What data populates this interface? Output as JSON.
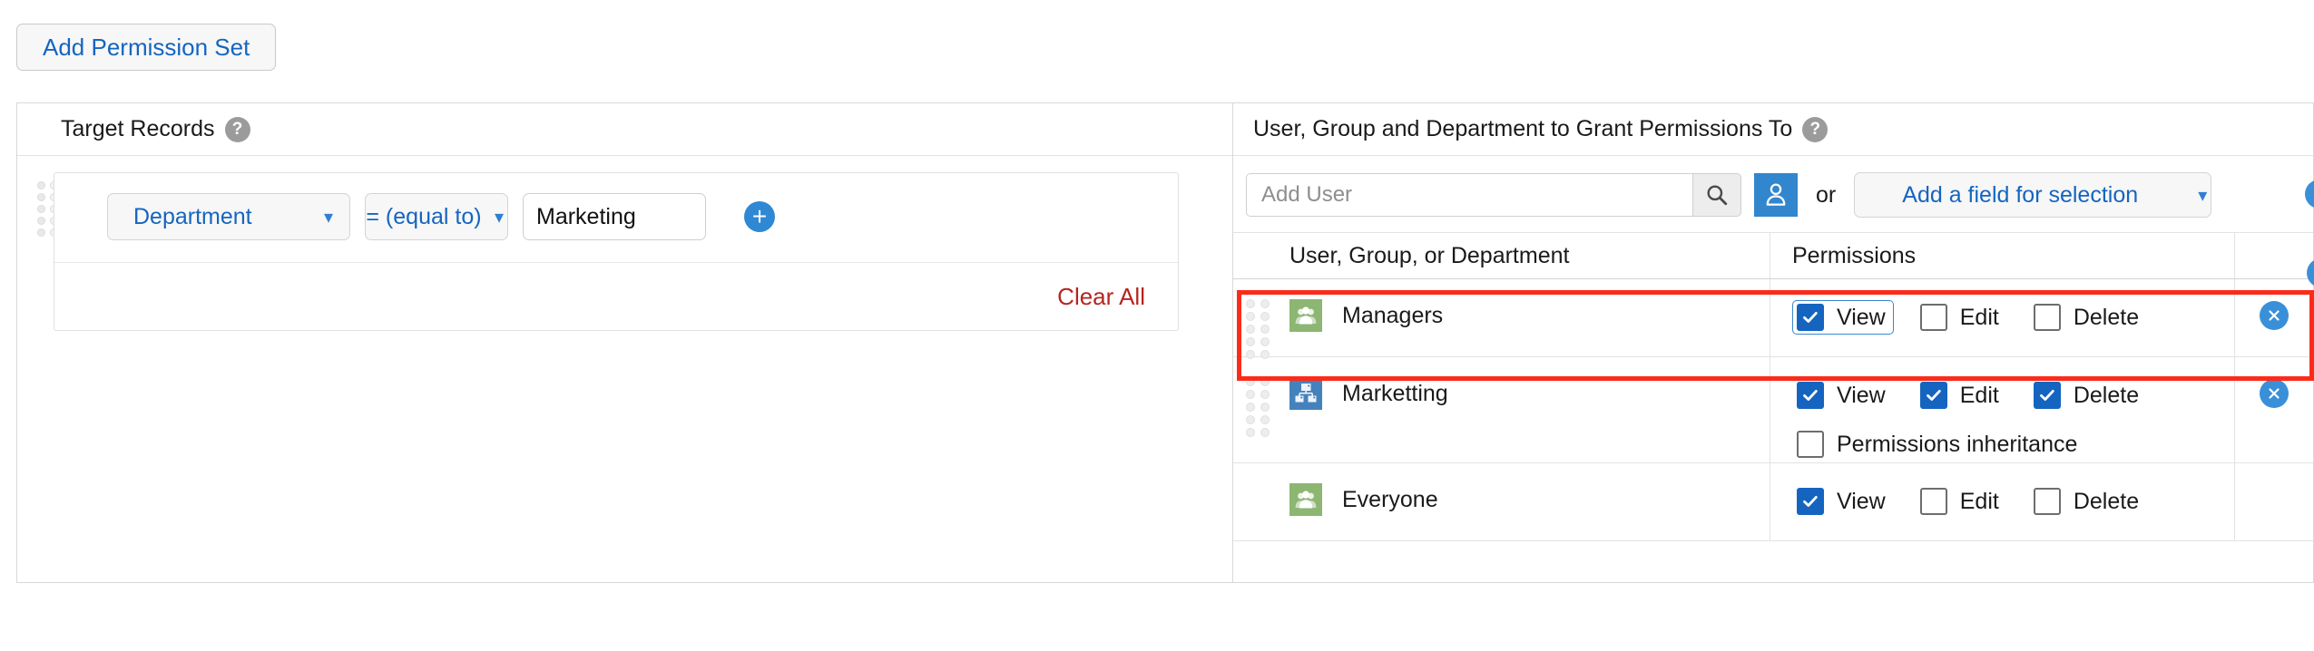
{
  "toolbar": {
    "add_permission_set_label": "Add Permission Set"
  },
  "left_panel": {
    "title": "Target Records",
    "help_icon": "help-circle-icon",
    "filter": {
      "field_value": "Department",
      "operator_value": "= (equal to)",
      "text_value": "Marketing",
      "text_placeholder": "",
      "add_icon": "plus-icon",
      "chevron_icon": "chevron-down-icon"
    },
    "clear_all_label": "Clear All",
    "clear_all_color": "#b5251f"
  },
  "right_panel": {
    "title": "User, Group and Department to Grant Permissions To",
    "help_icon": "help-circle-icon",
    "search": {
      "value": "",
      "placeholder": "Add User",
      "search_icon": "search-icon",
      "user_picker_icon": "user-icon",
      "or_label": "or",
      "add_field_label": "Add a field for selection",
      "chevron_icon": "chevron-down-icon"
    },
    "table": {
      "headers": {
        "name": "User, Group, or Department",
        "permissions": "Permissions",
        "actions": ""
      },
      "rows": [
        {
          "name": "Managers",
          "icon": "group-icon",
          "icon_kind": "group",
          "has_drag_handle": true,
          "has_remove": true,
          "remove_icon": "close-circle-icon",
          "highlighted": true,
          "permissions": [
            {
              "label": "View",
              "checked": true,
              "focused": true
            },
            {
              "label": "Edit",
              "checked": false,
              "focused": false
            },
            {
              "label": "Delete",
              "checked": false,
              "focused": false
            }
          ],
          "inheritance": null
        },
        {
          "name": "Marketting",
          "icon": "department-icon",
          "icon_kind": "dept",
          "has_drag_handle": true,
          "has_remove": true,
          "remove_icon": "close-circle-icon",
          "highlighted": false,
          "permissions": [
            {
              "label": "View",
              "checked": true,
              "focused": false
            },
            {
              "label": "Edit",
              "checked": true,
              "focused": false
            },
            {
              "label": "Delete",
              "checked": true,
              "focused": false
            }
          ],
          "inheritance": {
            "label": "Permissions inheritance",
            "checked": false
          }
        },
        {
          "name": "Everyone",
          "icon": "group-icon",
          "icon_kind": "group",
          "has_drag_handle": false,
          "has_remove": false,
          "remove_icon": "",
          "highlighted": false,
          "permissions": [
            {
              "label": "View",
              "checked": true,
              "focused": false
            },
            {
              "label": "Edit",
              "checked": false,
              "focused": false
            },
            {
              "label": "Delete",
              "checked": false,
              "focused": false
            }
          ],
          "inheritance": null
        }
      ]
    }
  },
  "colors": {
    "accent_blue": "#1565c0",
    "button_blue": "#3a90d8",
    "group_green": "#8cb671",
    "dept_blue": "#4482bd",
    "danger_red": "#b5251f",
    "highlight_red": "#fc2b19"
  }
}
